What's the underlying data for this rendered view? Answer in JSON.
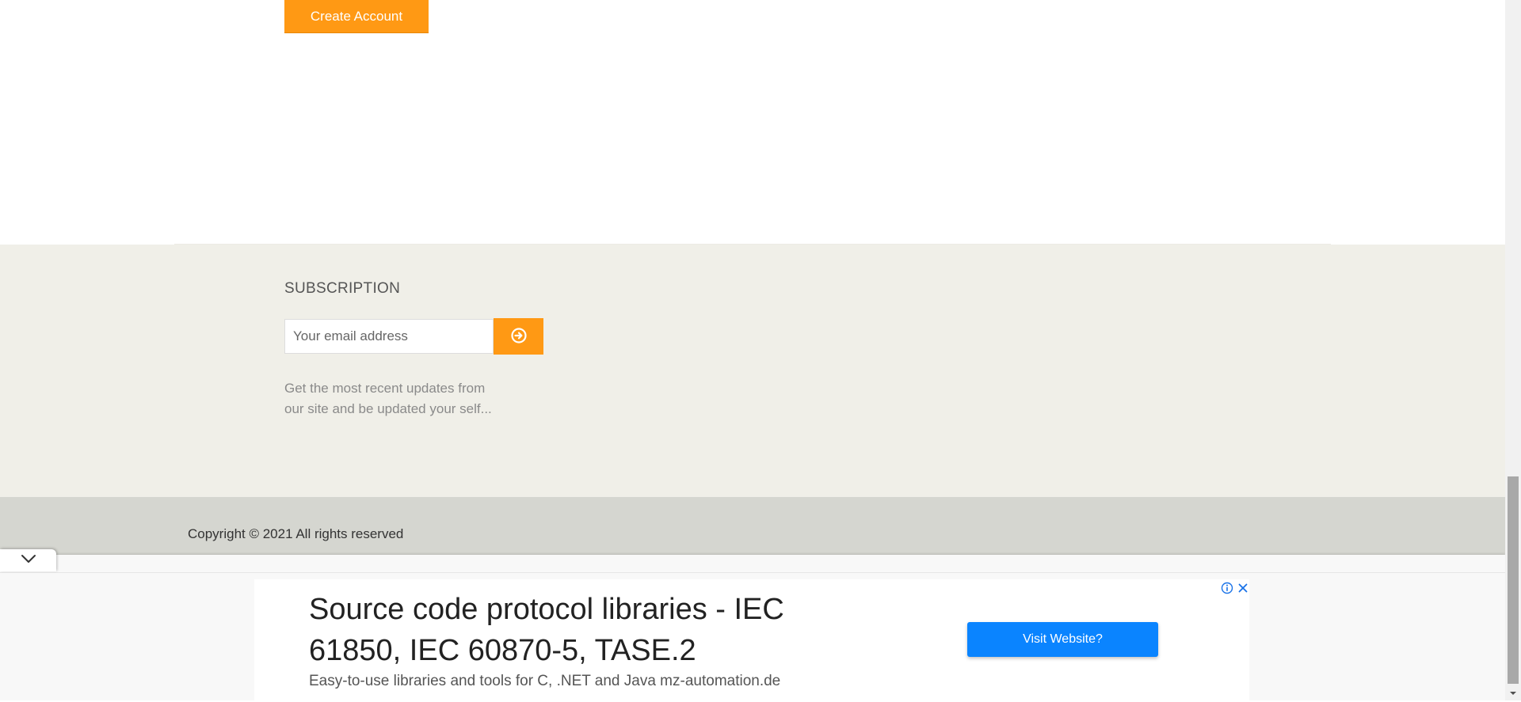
{
  "account": {
    "create_button_label": "Create Account"
  },
  "subscription": {
    "title": "SUBSCRIPTION",
    "email_placeholder": "Your email address",
    "submit_icon": "arrow-circle-right-icon",
    "description": "Get the most recent updates from our site and be updated your self..."
  },
  "footer": {
    "copyright": "Copyright © 2021 All rights reserved"
  },
  "ad": {
    "collapse_icon": "chevron-down-icon",
    "headline": "Source code protocol libraries - IEC 61850, IEC 60870-5, TASE.2",
    "description": "Easy-to-use libraries and tools for C, .NET and Java mz-automation.de",
    "cta_label": "Visit Website?",
    "info_icon": "info-icon",
    "close_icon": "close-icon"
  },
  "colors": {
    "accent": "#ff9914",
    "subscription_bg": "#f0efe8",
    "footer_bg": "#d5d6d0",
    "ad_cta": "#0a84ff"
  }
}
